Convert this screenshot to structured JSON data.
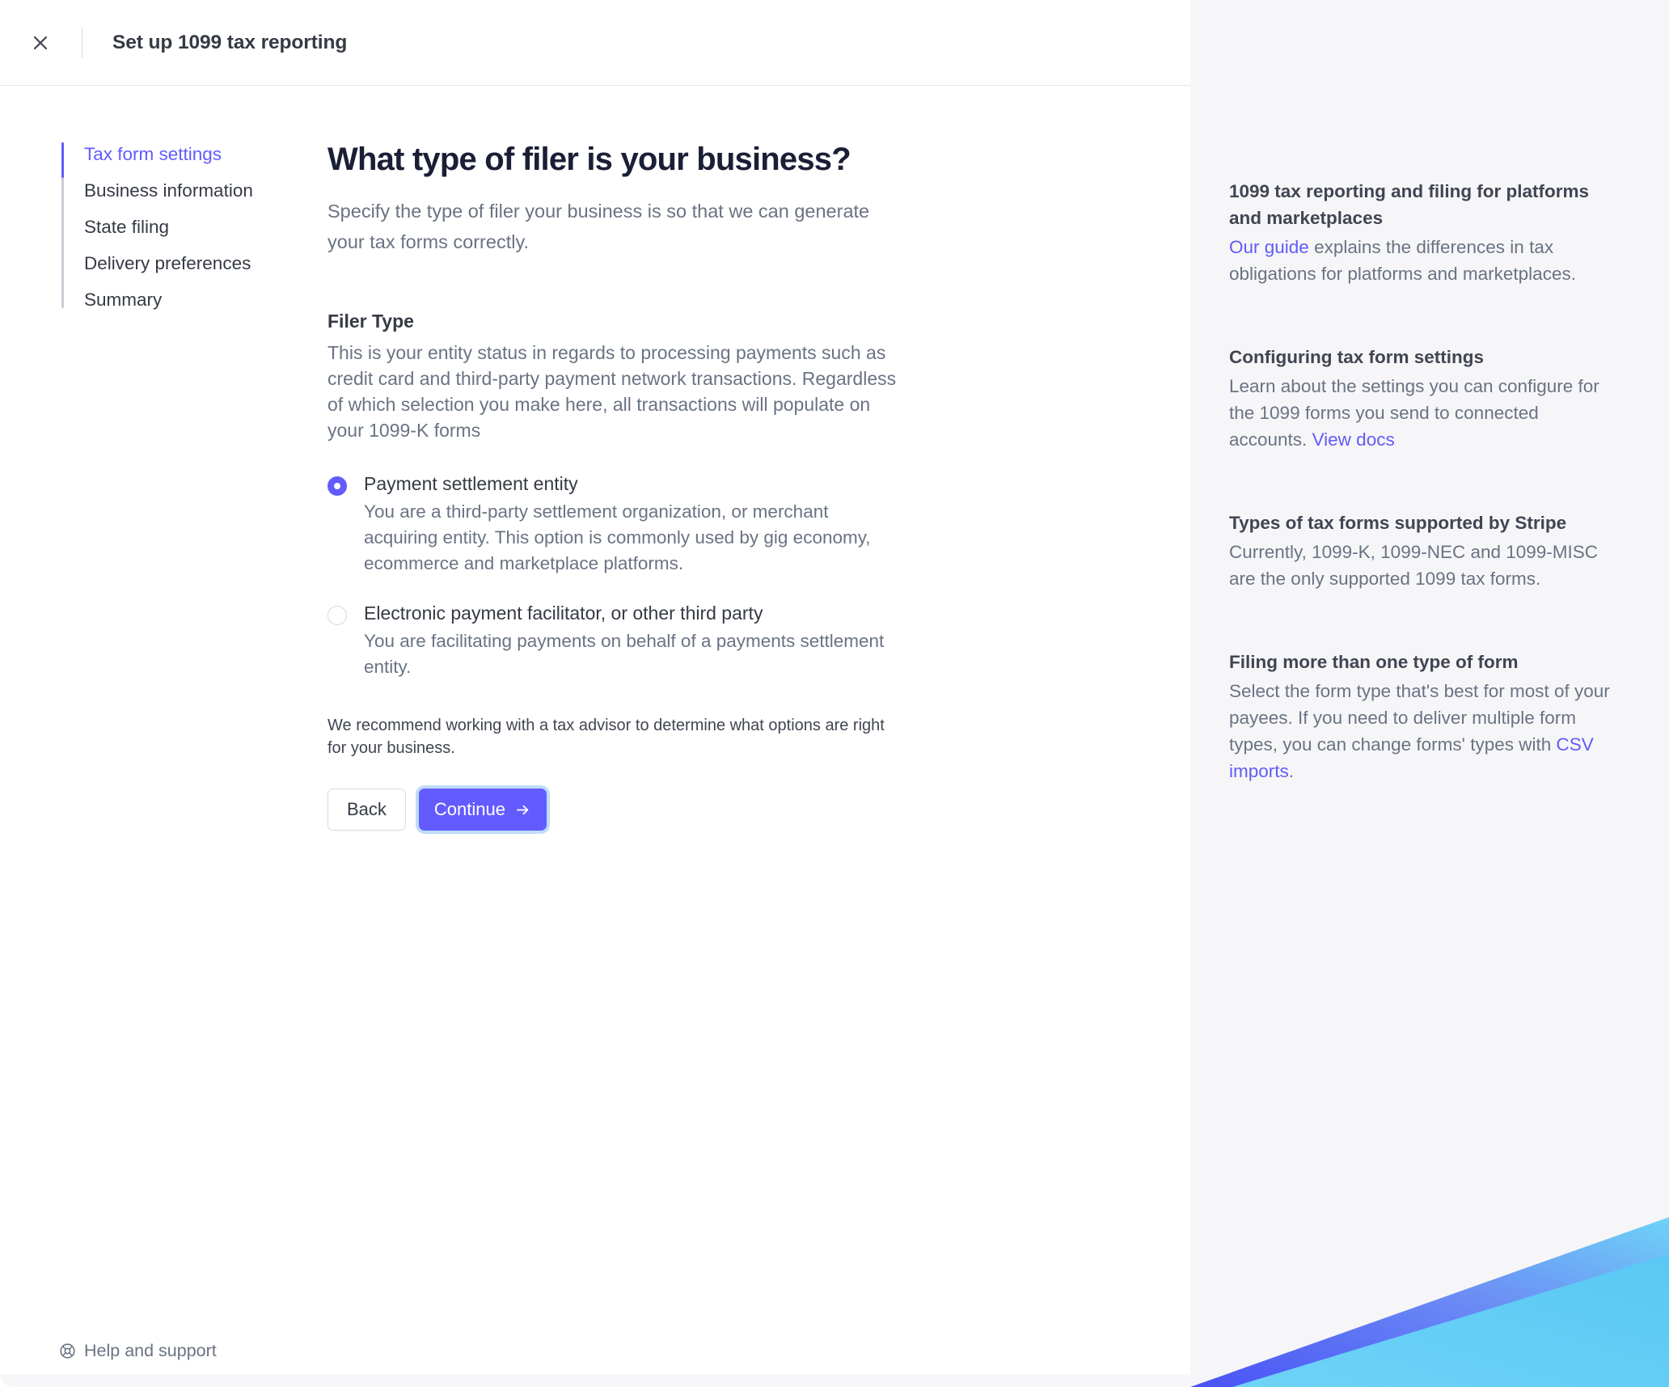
{
  "header": {
    "close_icon": "close-icon",
    "title": "Set up 1099 tax reporting"
  },
  "stepper": {
    "items": [
      {
        "label": "Tax form settings",
        "active": true
      },
      {
        "label": "Business information",
        "active": false
      },
      {
        "label": "State filing",
        "active": false
      },
      {
        "label": "Delivery preferences",
        "active": false
      },
      {
        "label": "Summary",
        "active": false
      }
    ]
  },
  "content": {
    "title": "What type of filer is your business?",
    "subtitle": "Specify the type of filer your business is so that we can generate your tax forms correctly.",
    "field_label": "Filer Type",
    "field_description": "This is your entity status in regards to processing payments such as credit card and third-party payment network transactions. Regardless of which selection you make here, all transactions will populate on your 1099-K forms",
    "options": [
      {
        "title": "Payment settlement entity",
        "description": "You are a third-party settlement organization, or merchant acquiring entity. This option is commonly used by gig economy, ecommerce and marketplace platforms.",
        "selected": true
      },
      {
        "title": "Electronic payment facilitator, or other third party",
        "description": "You are facilitating payments on behalf of a payments settlement entity.",
        "selected": false
      }
    ],
    "advisor_note": "We recommend working with a tax advisor to determine what options are right for your business.",
    "back_label": "Back",
    "continue_label": "Continue"
  },
  "footer": {
    "help_label": "Help and support",
    "help_icon": "lifebuoy-icon"
  },
  "side_panel": {
    "blocks": [
      {
        "title": "1099 tax reporting and filing for platforms and marketplaces",
        "link_text": "Our guide",
        "link_position": "start",
        "body": " explains the differences in tax obligations for platforms and marketplaces."
      },
      {
        "title": "Configuring tax form settings",
        "body": "Learn about the settings you can configure for the 1099 forms you send to connected accounts. ",
        "link_text": "View docs",
        "link_position": "end",
        "body_after": ""
      },
      {
        "title": "Types of tax forms supported by Stripe",
        "body": "Currently, 1099-K, 1099-NEC and 1099-MISC are the only supported 1099 tax forms."
      },
      {
        "title": "Filing more than one type of form",
        "body": "Select the form type that's best for most of your payees. If you need to deliver multiple form types, you can change forms' types with ",
        "link_text": "CSV imports",
        "link_position": "end",
        "body_after": "."
      }
    ]
  },
  "colors": {
    "accent": "#635bff",
    "link": "#625bf6",
    "focus_ring": "#bfdcf7",
    "panel_bg": "#f6f6f8",
    "text_primary": "#353a44",
    "text_secondary": "#6a7383",
    "art_dark_blue": "#4a5cf0",
    "art_mid_blue": "#6b8cf5",
    "art_light_blue": "#6cd1f5",
    "art_cyan": "#5ec9f2"
  }
}
